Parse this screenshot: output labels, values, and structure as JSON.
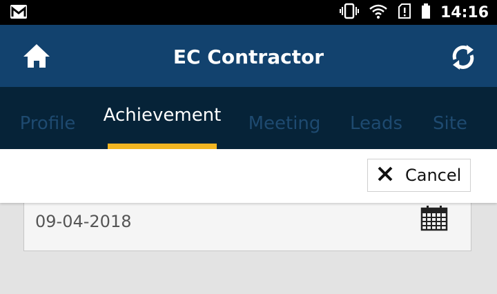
{
  "status_bar": {
    "time": "14:16",
    "icons": [
      "gmail-icon",
      "vibrate-icon",
      "wifi-icon",
      "sim-alert-icon",
      "battery-icon"
    ]
  },
  "app_bar": {
    "title": "EC Contractor",
    "left_icon": "home-icon",
    "right_icon": "refresh-icon",
    "background": "#12426e"
  },
  "tabs": [
    {
      "label": "Profile",
      "active": false
    },
    {
      "label": "Achievement",
      "active": true
    },
    {
      "label": "Meeting",
      "active": false
    },
    {
      "label": "Leads",
      "active": false
    },
    {
      "label": "Site",
      "active": false
    }
  ],
  "colors": {
    "tab_bar": "#062338",
    "tab_inactive_text": "#1e4a70",
    "tab_indicator": "#f2b521"
  },
  "actions": {
    "cancel_label": "Cancel",
    "cancel_icon": "close-icon"
  },
  "form": {
    "date_value": "09-04-2018",
    "date_icon": "calendar-icon"
  }
}
